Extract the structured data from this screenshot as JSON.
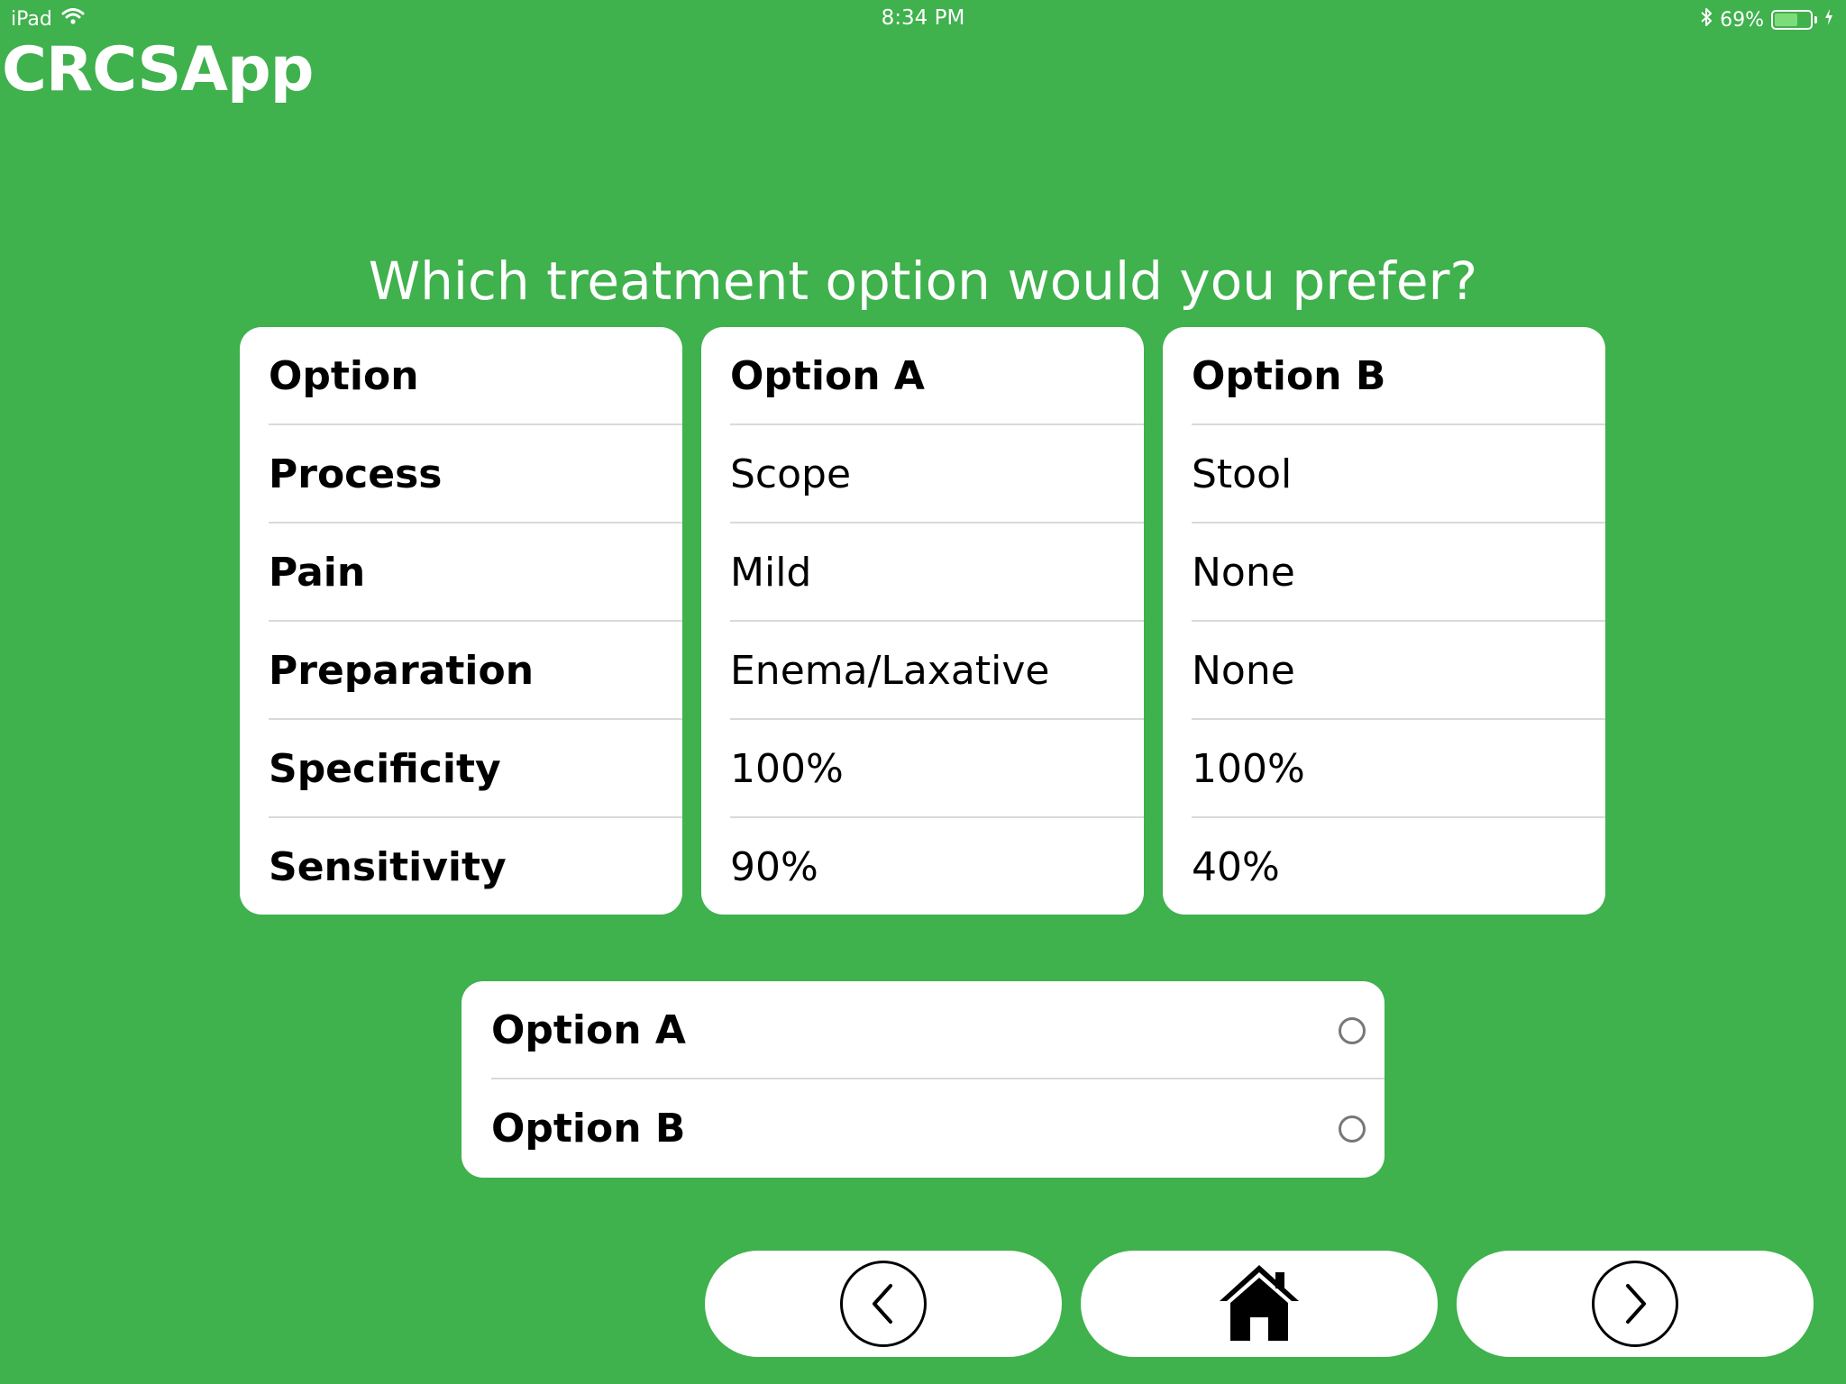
{
  "status_bar": {
    "device": "iPad",
    "time": "8:34 PM",
    "battery_percent": "69%",
    "battery_level": 0.69
  },
  "app": {
    "title": "CRCSApp"
  },
  "question": "Which treatment option would you prefer?",
  "columns": [
    {
      "header": "Option",
      "rows": [
        "Process",
        "Pain",
        "Preparation",
        "Specificity",
        "Sensitivity"
      ],
      "bold": true
    },
    {
      "header": "Option A",
      "rows": [
        "Scope",
        "Mild",
        "Enema/Laxative",
        "100%",
        "90%"
      ],
      "bold": false
    },
    {
      "header": "Option B",
      "rows": [
        "Stool",
        "None",
        "None",
        "100%",
        "40%"
      ],
      "bold": false
    }
  ],
  "choices": [
    {
      "label": "Option A",
      "selected": false
    },
    {
      "label": "Option B",
      "selected": false
    }
  ],
  "nav": {
    "back_icon": "chevron-left-icon",
    "home_icon": "home-icon",
    "forward_icon": "chevron-right-icon"
  },
  "colors": {
    "background": "#3fb14d",
    "card": "#ffffff",
    "text": "#000000"
  }
}
